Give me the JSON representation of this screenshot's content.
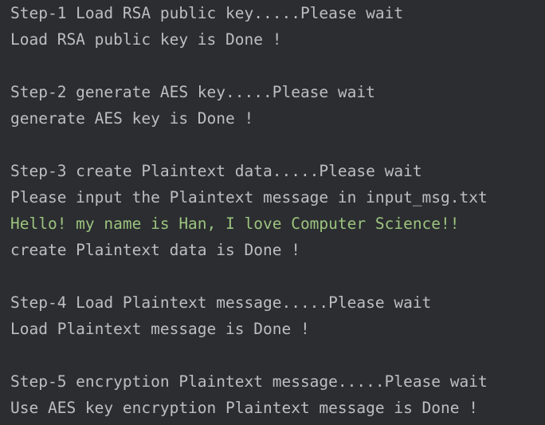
{
  "console": {
    "lines": [
      {
        "text": "Step-1 Load RSA public key.....Please wait",
        "kind": "stdout"
      },
      {
        "text": "Load RSA public key is Done !",
        "kind": "stdout"
      },
      {
        "text": "",
        "kind": "blank"
      },
      {
        "text": "Step-2 generate AES key.....Please wait",
        "kind": "stdout"
      },
      {
        "text": "generate AES key is Done !",
        "kind": "stdout"
      },
      {
        "text": "",
        "kind": "blank"
      },
      {
        "text": "Step-3 create Plaintext data.....Please wait",
        "kind": "stdout"
      },
      {
        "text": "Please input the Plaintext message in input_msg.txt",
        "kind": "stdout"
      },
      {
        "text": "Hello! my name is Han, I love Computer Science!!",
        "kind": "input"
      },
      {
        "text": "create Plaintext data is Done !",
        "kind": "stdout"
      },
      {
        "text": "",
        "kind": "blank"
      },
      {
        "text": "Step-4 Load Plaintext message.....Please wait",
        "kind": "stdout"
      },
      {
        "text": "Load Plaintext message is Done !",
        "kind": "stdout"
      },
      {
        "text": "",
        "kind": "blank"
      },
      {
        "text": "Step-5 encryption Plaintext message.....Please wait",
        "kind": "stdout"
      },
      {
        "text": "Use AES key encryption Plaintext message is Done !",
        "kind": "stdout"
      }
    ]
  },
  "colors": {
    "background": "#2b2d30",
    "stdout_text": "#bcbec4",
    "input_text": "#9cc47f"
  }
}
